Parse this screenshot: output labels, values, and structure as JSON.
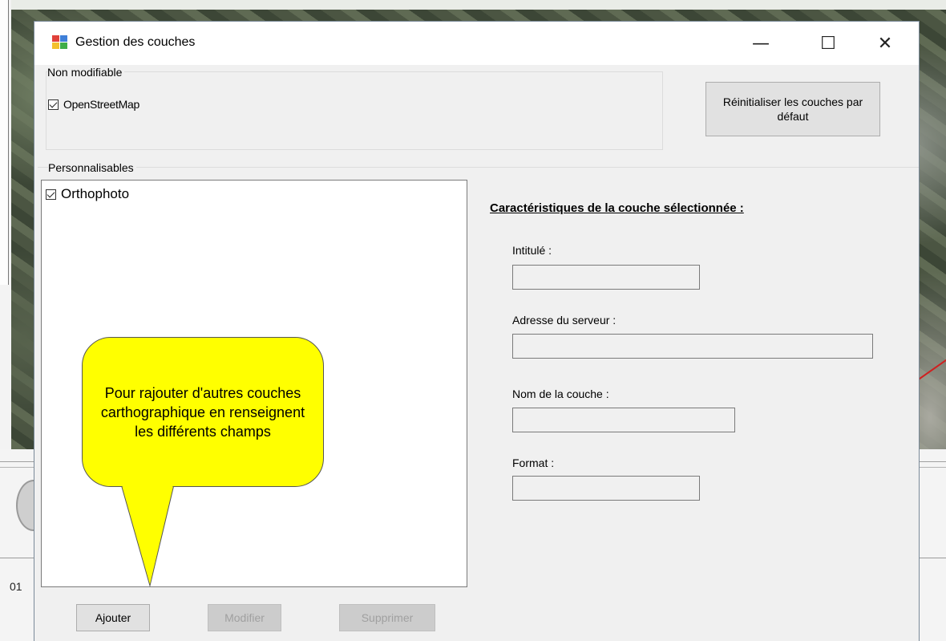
{
  "window": {
    "title": "Gestion des couches",
    "controls": {
      "minimize": "—",
      "maximize": "☐",
      "close": "✕"
    }
  },
  "fixed_group": {
    "label": "Non modifiable",
    "items": [
      {
        "label": "OpenStreetMap",
        "checked": true
      }
    ]
  },
  "reset_button": {
    "label": "Réinitialiser les couches par défaut"
  },
  "custom_group": {
    "label": "Personnalisables",
    "items": [
      {
        "label": "Orthophoto",
        "checked": true
      }
    ]
  },
  "properties": {
    "title": "Caractéristiques de la couche sélectionnée :",
    "fields": [
      {
        "label": "Intitulé :",
        "value": ""
      },
      {
        "label": "Adresse du serveur :",
        "value": ""
      },
      {
        "label": "Nom de la couche :",
        "value": ""
      },
      {
        "label": "Format :",
        "value": ""
      }
    ]
  },
  "buttons": {
    "add": "Ajouter",
    "edit": "Modifier",
    "delete": "Supprimer"
  },
  "callout": {
    "text": "Pour rajouter d'autres couches carthographique en renseignent les différents champs",
    "color": "#ffff00"
  },
  "background": {
    "partial_text": "01"
  }
}
